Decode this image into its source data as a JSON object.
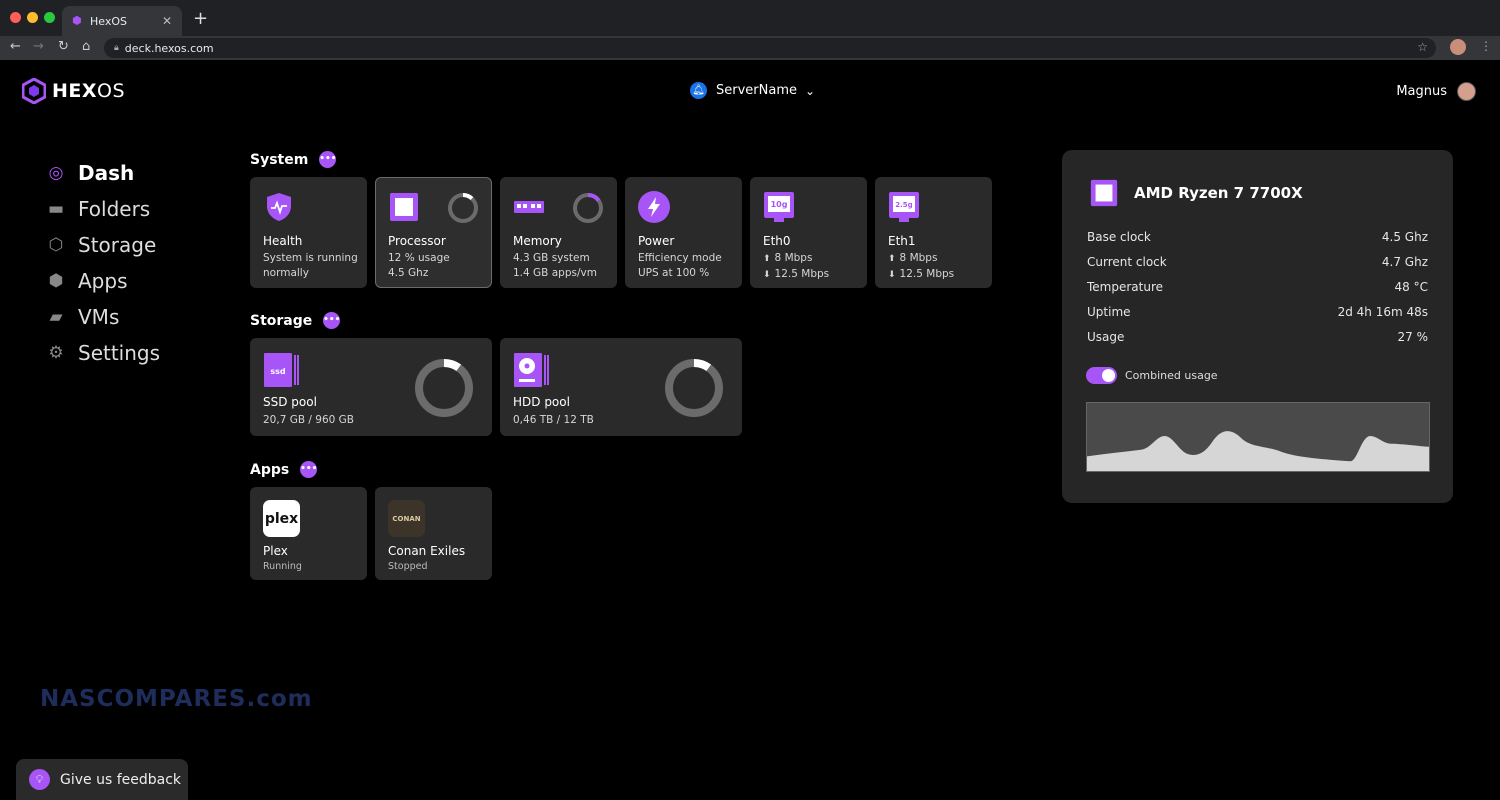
{
  "browser": {
    "tab_title": "HexOS",
    "tab_close": "✕",
    "new_tab": "+",
    "url": "deck.hexos.com"
  },
  "header": {
    "brand_bold": "HEX",
    "brand_light": "OS",
    "server_name": "ServerName",
    "user_name": "Magnus"
  },
  "sidebar": {
    "items": [
      {
        "label": "Dash",
        "icon": "dash-icon"
      },
      {
        "label": "Folders",
        "icon": "folder-icon"
      },
      {
        "label": "Storage",
        "icon": "storage-icon"
      },
      {
        "label": "Apps",
        "icon": "apps-icon"
      },
      {
        "label": "VMs",
        "icon": "vm-icon"
      },
      {
        "label": "Settings",
        "icon": "gear-icon"
      }
    ]
  },
  "system": {
    "heading": "System",
    "cards": {
      "health": {
        "title": "Health",
        "sub": "System is running normally"
      },
      "processor": {
        "title": "Processor",
        "line1": "12 % usage",
        "line2": "4.5 Ghz",
        "usage_pct": 12
      },
      "memory": {
        "title": "Memory",
        "line1": "4.3 GB system",
        "line2": "1.4 GB apps/vm",
        "usage_pct": 15
      },
      "power": {
        "title": "Power",
        "line1": "Efficiency mode",
        "line2": "UPS at 100 %"
      },
      "eth0": {
        "title": "Eth0",
        "badge": "10g",
        "up": "8 Mbps",
        "down": "12.5 Mbps"
      },
      "eth1": {
        "title": "Eth1",
        "badge": "2.5g",
        "up": "8 Mbps",
        "down": "12.5 Mbps"
      }
    }
  },
  "storage": {
    "heading": "Storage",
    "pools": {
      "ssd": {
        "title": "SSD pool",
        "sub": "20,7 GB / 960 GB",
        "badge": "ssd",
        "usage_pct": 10
      },
      "hdd": {
        "title": "HDD pool",
        "sub": "0,46 TB / 12 TB",
        "usage_pct": 10
      }
    }
  },
  "apps": {
    "heading": "Apps",
    "items": {
      "plex": {
        "title": "Plex",
        "status": "Running",
        "logo_text": "plex"
      },
      "conan": {
        "title": "Conan Exiles",
        "status": "Stopped",
        "logo_text": "CONAN"
      }
    }
  },
  "detail": {
    "title": "AMD Ryzen 7 7700X",
    "rows": [
      {
        "label": "Base clock",
        "value": "4.5 Ghz"
      },
      {
        "label": "Current clock",
        "value": "4.7 Ghz"
      },
      {
        "label": "Temperature",
        "value": "48 °C"
      },
      {
        "label": "Uptime",
        "value": "2d 4h 16m 48s"
      },
      {
        "label": "Usage",
        "value": "27 %"
      }
    ],
    "toggle_label": "Combined usage",
    "toggle_on": true
  },
  "watermark": "NASCOMPARES.com",
  "feedback": {
    "label": "Give us feedback"
  },
  "colors": {
    "accent": "#a855f7",
    "card": "#2a2a2a",
    "panel": "#262626",
    "server_badge": "#1a73e8"
  }
}
